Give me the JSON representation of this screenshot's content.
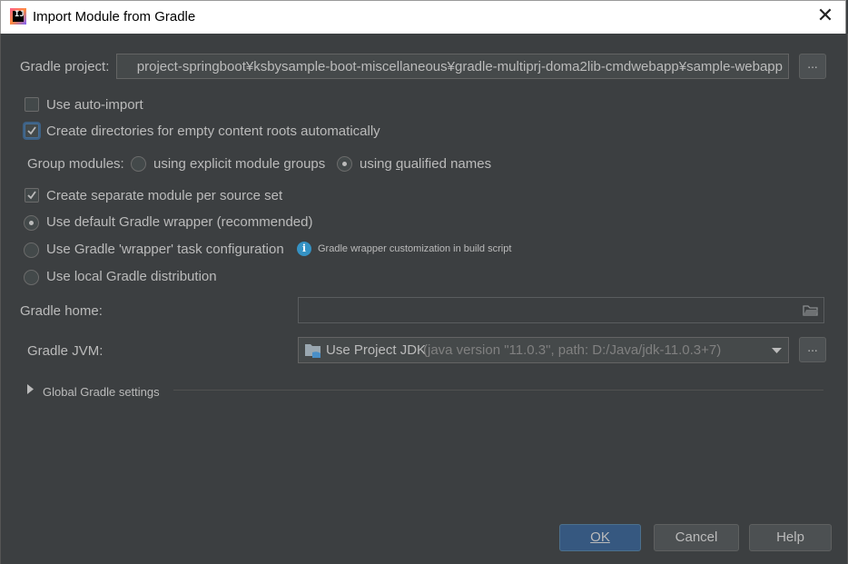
{
  "window": {
    "title": "Import Module from Gradle",
    "close_glyph": "✕"
  },
  "gradle_project": {
    "label": "Gradle project:",
    "value": "project-springboot¥ksbysample-boot-miscellaneous¥gradle-multiprj-doma2lib-cmdwebapp¥sample-webapp",
    "browse_label": "..."
  },
  "options": {
    "auto_import": {
      "label": "Use auto-import",
      "checked": false
    },
    "create_dirs": {
      "label": "Create directories for empty content roots automatically",
      "checked": true
    },
    "group_modules": {
      "label": "Group modules:",
      "explicit": "using explicit module groups",
      "qualified_pre": "using ",
      "qualified_mnemonic": "q",
      "qualified_post": "ualified names",
      "selected": "qualified"
    },
    "separate_module": {
      "label": "Create separate module per source set",
      "checked": true
    },
    "wrapper_default": {
      "label": "Use default Gradle wrapper (recommended)",
      "selected": true
    },
    "wrapper_task": {
      "label": "Use Gradle 'wrapper' task configuration",
      "selected": false
    },
    "wrapper_info": "Gradle wrapper customization in build script",
    "local_dist": {
      "label": "Use local Gradle distribution",
      "selected": false
    }
  },
  "gradle_home": {
    "label": "Gradle home:",
    "value": ""
  },
  "gradle_jvm": {
    "label": "Gradle JVM:",
    "selected_name": "Use Project JDK",
    "selected_detail": "(java version \"11.0.3\", path: D:/Java/jdk-11.0.3+7)",
    "browse_label": "..."
  },
  "global_settings": {
    "label": "Global Gradle settings"
  },
  "buttons": {
    "ok": "OK",
    "cancel": "Cancel",
    "help": "Help"
  },
  "colors": {
    "background": "#3c3f41",
    "accent": "#365880",
    "info": "#3592c4"
  },
  "icons": [
    "app-icon",
    "close-icon",
    "check-icon",
    "info-icon",
    "folder-icon",
    "chevron-down-icon",
    "triangle-right-icon"
  ]
}
